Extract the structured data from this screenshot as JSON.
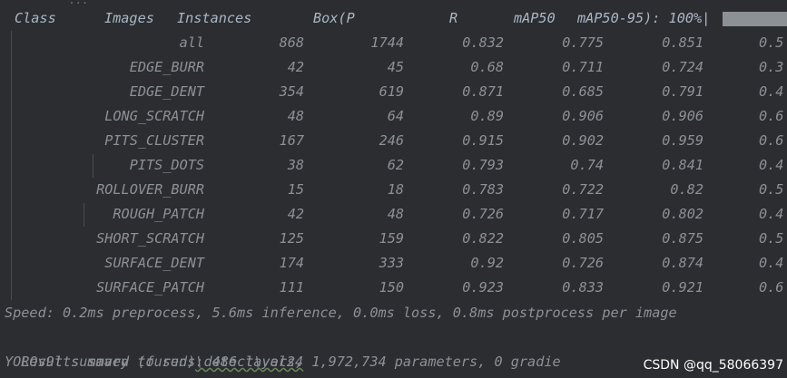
{
  "header": {
    "class": "Class",
    "images": "Images",
    "instances": "Instances",
    "box_p": "Box(P",
    "r": "R",
    "map50": "mAP50",
    "map50_95": "mAP50-95): 100%|",
    "fragment_above": "..."
  },
  "rows": [
    {
      "cls": "all",
      "images": "868",
      "instances": "1744",
      "p": "0.832",
      "r": "0.775",
      "map50": "0.851",
      "map50_95": "0.5"
    },
    {
      "cls": "EDGE_BURR",
      "images": "42",
      "instances": "45",
      "p": "0.68",
      "r": "0.711",
      "map50": "0.724",
      "map50_95": "0.3"
    },
    {
      "cls": "EDGE_DENT",
      "images": "354",
      "instances": "619",
      "p": "0.871",
      "r": "0.685",
      "map50": "0.791",
      "map50_95": "0.4"
    },
    {
      "cls": "LONG_SCRATCH",
      "images": "48",
      "instances": "64",
      "p": "0.89",
      "r": "0.906",
      "map50": "0.906",
      "map50_95": "0.6"
    },
    {
      "cls": "PITS_CLUSTER",
      "images": "167",
      "instances": "246",
      "p": "0.915",
      "r": "0.902",
      "map50": "0.959",
      "map50_95": "0.6"
    },
    {
      "cls": "PITS_DOTS",
      "images": "38",
      "instances": "62",
      "p": "0.793",
      "r": "0.74",
      "map50": "0.841",
      "map50_95": "0.4"
    },
    {
      "cls": "ROLLOVER_BURR",
      "images": "15",
      "instances": "18",
      "p": "0.783",
      "r": "0.722",
      "map50": "0.82",
      "map50_95": "0.5"
    },
    {
      "cls": "ROUGH_PATCH",
      "images": "42",
      "instances": "48",
      "p": "0.726",
      "r": "0.717",
      "map50": "0.802",
      "map50_95": "0.4"
    },
    {
      "cls": "SHORT_SCRATCH",
      "images": "125",
      "instances": "159",
      "p": "0.822",
      "r": "0.805",
      "map50": "0.875",
      "map50_95": "0.5"
    },
    {
      "cls": "SURFACE_DENT",
      "images": "174",
      "instances": "333",
      "p": "0.92",
      "r": "0.726",
      "map50": "0.874",
      "map50_95": "0.4"
    },
    {
      "cls": "SURFACE_PATCH",
      "images": "111",
      "instances": "150",
      "p": "0.923",
      "r": "0.833",
      "map50": "0.921",
      "map50_95": "0.6"
    }
  ],
  "log": {
    "speed": "Speed: 0.2ms preprocess, 5.6ms inference, 0.0ms loss, 0.8ms postprocess per image",
    "results_prefix": "Results saved to runs",
    "results_path": "\\detect\\val24",
    "summary": "YOLOv9t summary (fused): 486 layers, 1,972,734 parameters, 0 gradie"
  },
  "watermark": "CSDN @qq_58066397",
  "colors": {
    "background": "#2b2d30",
    "header_text": "#a9b7c6",
    "row_text": "#8c9196",
    "guide": "#4a4d52",
    "underline": "#6a8759"
  }
}
